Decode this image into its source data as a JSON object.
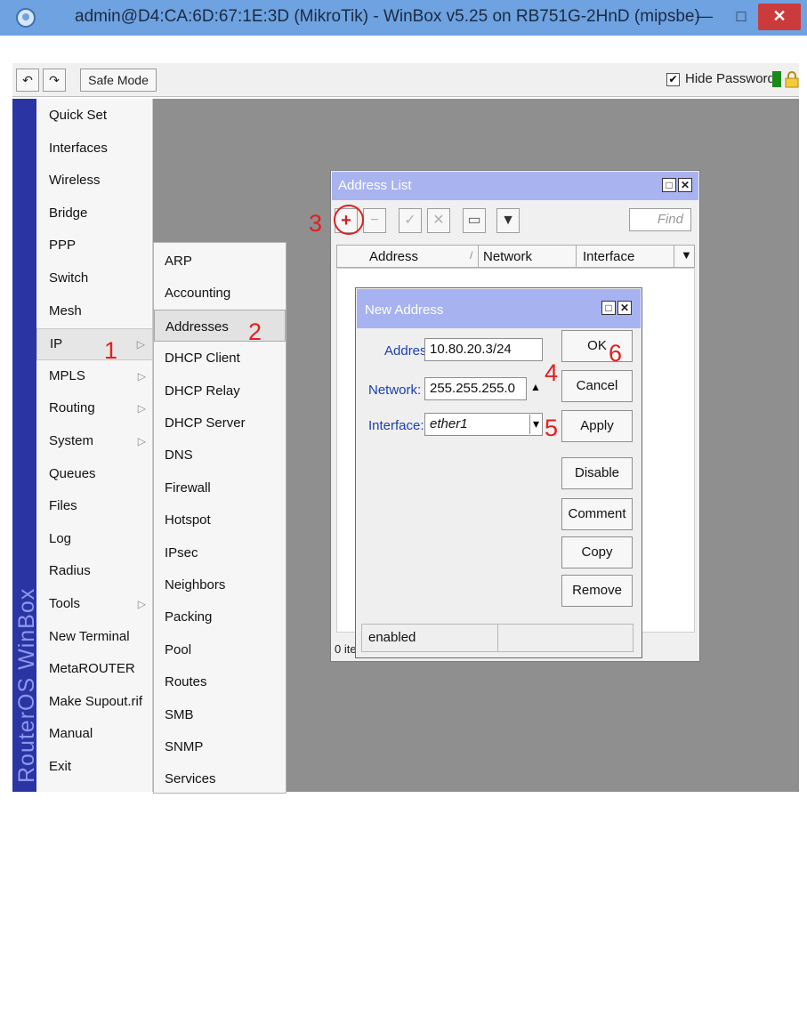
{
  "window": {
    "title": "admin@D4:CA:6D:67:1E:3D (MikroTik) - WinBox v5.25 on RB751G-2HnD (mipsbe)",
    "minimize_glyph": "—",
    "maximize_glyph": "□",
    "close_glyph": "✕"
  },
  "toolbar": {
    "undo_icon": "↶",
    "redo_icon": "↷",
    "safe_mode_label": "Safe Mode",
    "hide_passwords_label": "Hide Passwords",
    "hide_passwords_checked": "✔"
  },
  "brand": "RouterOS WinBox",
  "sidebar": {
    "items": [
      {
        "label": "Quick Set",
        "arrow": ""
      },
      {
        "label": "Interfaces",
        "arrow": ""
      },
      {
        "label": "Wireless",
        "arrow": ""
      },
      {
        "label": "Bridge",
        "arrow": ""
      },
      {
        "label": "PPP",
        "arrow": ""
      },
      {
        "label": "Switch",
        "arrow": ""
      },
      {
        "label": "Mesh",
        "arrow": ""
      },
      {
        "label": "IP",
        "arrow": "▷"
      },
      {
        "label": "MPLS",
        "arrow": "▷"
      },
      {
        "label": "Routing",
        "arrow": "▷"
      },
      {
        "label": "System",
        "arrow": "▷"
      },
      {
        "label": "Queues",
        "arrow": ""
      },
      {
        "label": "Files",
        "arrow": ""
      },
      {
        "label": "Log",
        "arrow": ""
      },
      {
        "label": "Radius",
        "arrow": ""
      },
      {
        "label": "Tools",
        "arrow": "▷"
      },
      {
        "label": "New Terminal",
        "arrow": ""
      },
      {
        "label": "MetaROUTER",
        "arrow": ""
      },
      {
        "label": "Make Supout.rif",
        "arrow": ""
      },
      {
        "label": "Manual",
        "arrow": ""
      },
      {
        "label": "Exit",
        "arrow": ""
      }
    ]
  },
  "submenu": {
    "items": [
      "ARP",
      "Accounting",
      "Addresses",
      "DHCP Client",
      "DHCP Relay",
      "DHCP Server",
      "DNS",
      "Firewall",
      "Hotspot",
      "IPsec",
      "Neighbors",
      "Packing",
      "Pool",
      "Routes",
      "SMB",
      "SNMP",
      "Services"
    ]
  },
  "address_list": {
    "title": "Address List",
    "find_placeholder": "Find",
    "buttons": {
      "add": "+",
      "remove": "−",
      "enable": "✓",
      "disable": "✕",
      "comment": "▭",
      "filter": "▼"
    },
    "columns": [
      "Address",
      "Network",
      "Interface"
    ],
    "sort_glyph": "/",
    "column_menu_glyph": "▼",
    "status": "0 ite",
    "window_controls": [
      "□",
      "✕"
    ]
  },
  "new_address": {
    "title": "New Address",
    "window_controls": [
      "□",
      "✕"
    ],
    "address_label": "Address:",
    "address_value": "10.80.20.3/24",
    "network_label": "Network:",
    "network_value": "255.255.255.0",
    "network_arrow": "▲",
    "interface_label": "Interface:",
    "interface_value": "ether1",
    "interface_dropdown": "▾",
    "buttons": [
      "OK",
      "Cancel",
      "Apply",
      "Disable",
      "Comment",
      "Copy",
      "Remove"
    ],
    "status": "enabled"
  },
  "annotations": [
    "1",
    "2",
    "3",
    "4",
    "5",
    "6"
  ],
  "colors": {
    "titlebar": "#6ea2e0",
    "brand_strip": "#2b34a3",
    "workspace": "#8f8f8f",
    "dialog_title": "#a7b2f0",
    "annotation": "#e02020"
  }
}
